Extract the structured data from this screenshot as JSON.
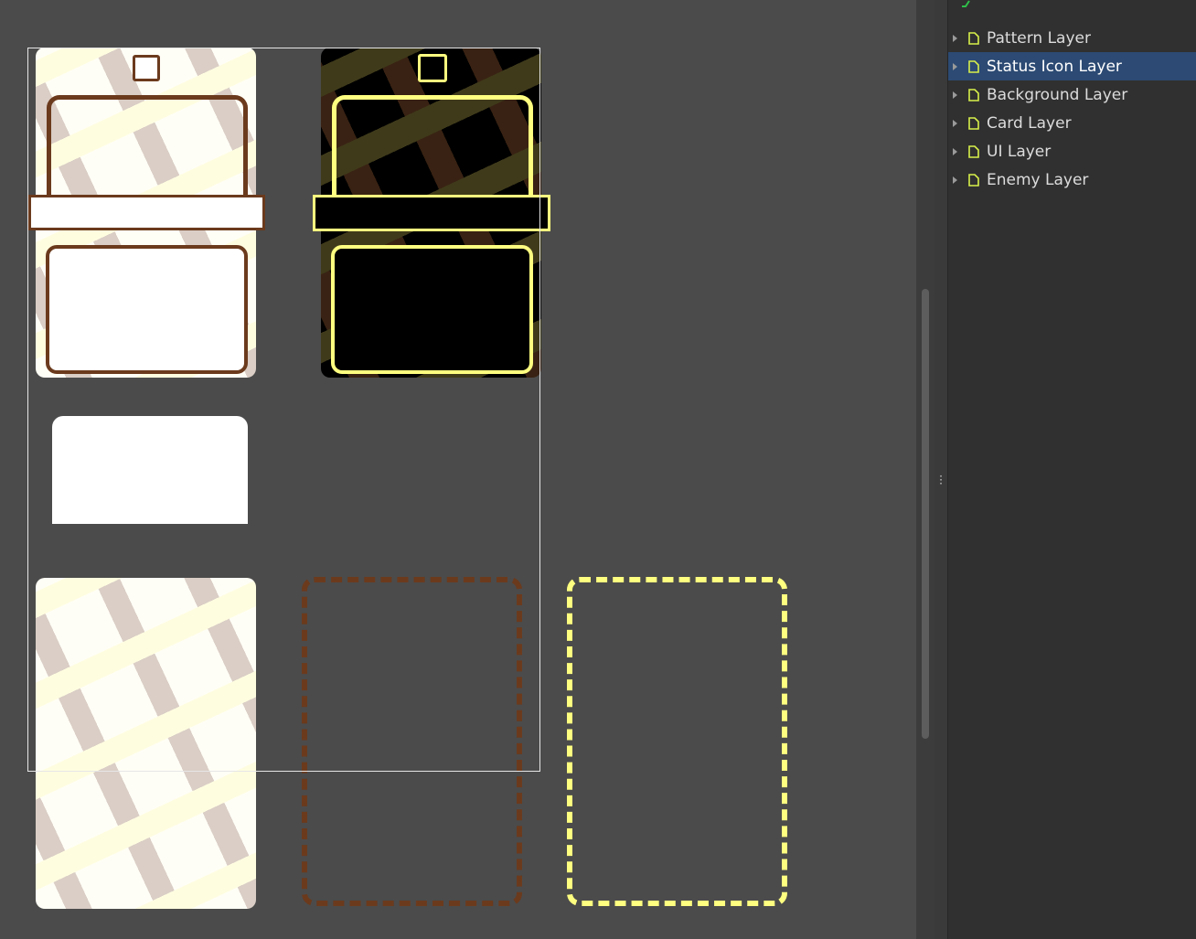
{
  "colors": {
    "canvas_bg": "#4b4b4b",
    "brown": "#6b3a1d",
    "yellow": "#ffff80",
    "selection": "#2c4a73",
    "layer_icon": "#d8f04a"
  },
  "layers_panel": {
    "items": [
      {
        "label": "Pattern Layer",
        "icon": "document-icon",
        "selected": false
      },
      {
        "label": "Status Icon Layer",
        "icon": "document-icon",
        "selected": true
      },
      {
        "label": "Background Layer",
        "icon": "document-icon",
        "selected": false
      },
      {
        "label": "Card Layer",
        "icon": "document-icon",
        "selected": false
      },
      {
        "label": "UI Layer",
        "icon": "document-icon",
        "selected": false
      },
      {
        "label": "Enemy Layer",
        "icon": "document-icon",
        "selected": false
      }
    ]
  }
}
